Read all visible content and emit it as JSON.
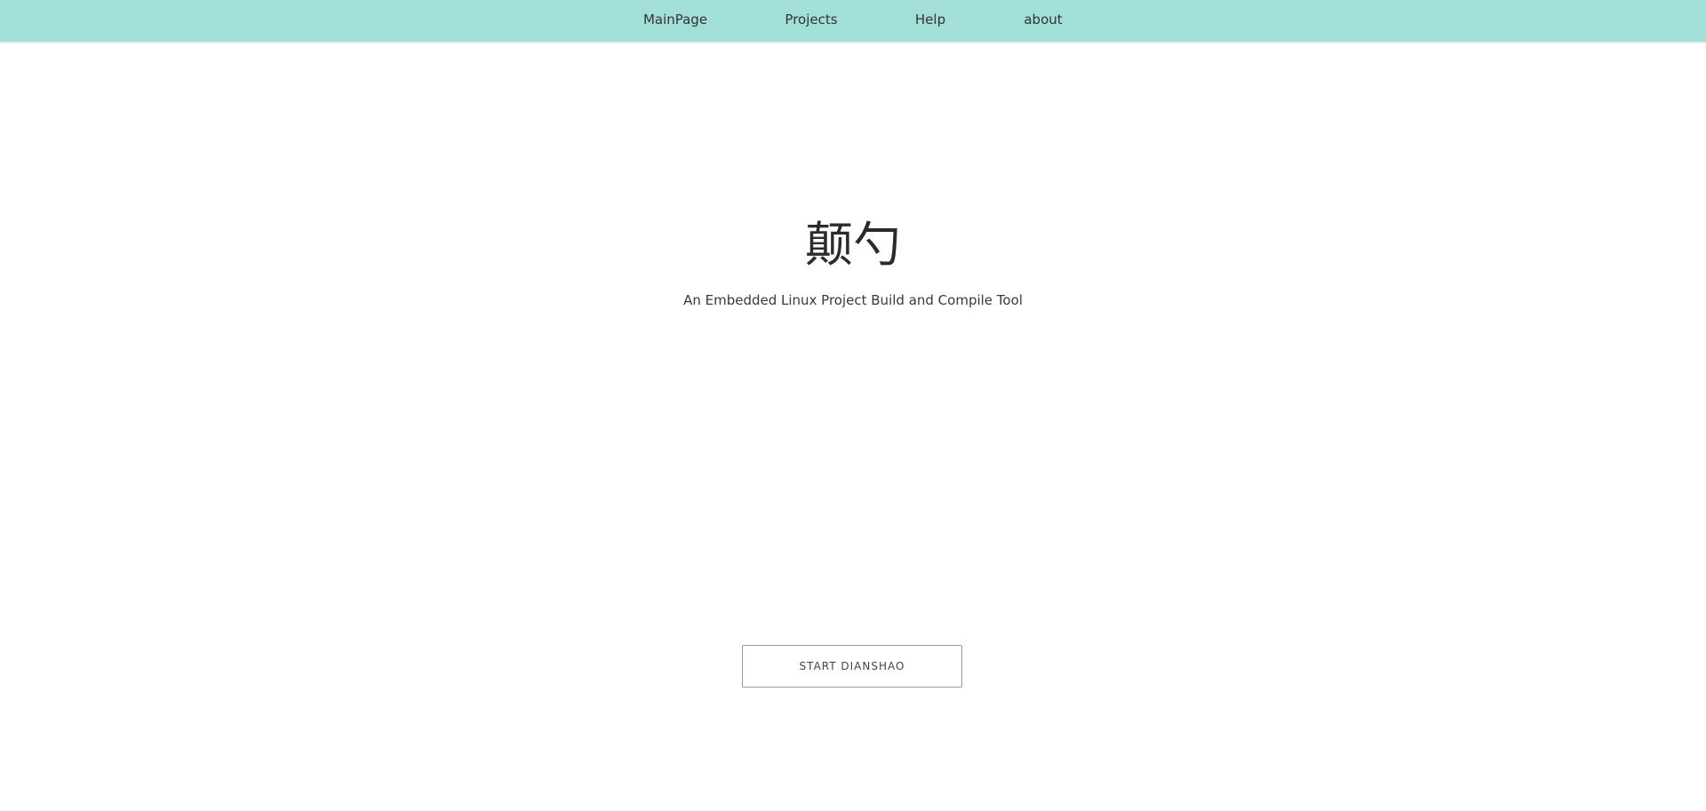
{
  "nav": {
    "items": [
      {
        "label": "MainPage"
      },
      {
        "label": "Projects"
      },
      {
        "label": "Help"
      },
      {
        "label": "about"
      }
    ]
  },
  "hero": {
    "title": "颠勺",
    "subtitle": "An Embedded Linux Project Build and Compile Tool"
  },
  "cta": {
    "label": "START DIANSHAO"
  },
  "colors": {
    "nav_background": "#a2dfd8",
    "page_background": "#ffffff",
    "text": "#333333",
    "button_border": "#999999"
  }
}
